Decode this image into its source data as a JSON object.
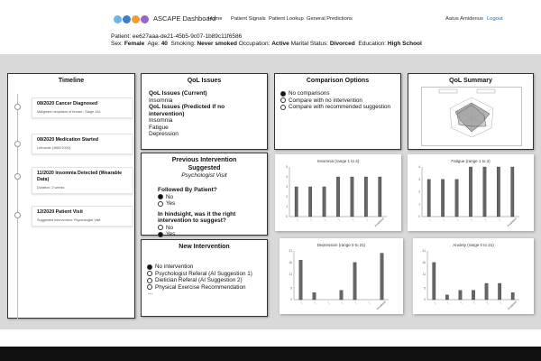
{
  "nav": {
    "brand": "ASCAPE Dashboard",
    "links": [
      "Home",
      "Patient Signals",
      "Patient Lookup",
      "General Predictions"
    ],
    "user": "Aatus Amidenus",
    "logout": "Logout",
    "logo_colors": [
      "#6bb7e8",
      "#3a7fc9",
      "#f29c38",
      "#9c64c9",
      "#58b96e"
    ]
  },
  "patient": {
    "label": "Patient:",
    "id": "ee627aaa-de21-45b5-9c07-1b89c11f6586",
    "sex_label": "Sex:",
    "sex": "Female",
    "age_label": "Age:",
    "age": "40",
    "smoking_label": "Smoking:",
    "smoking": "Never smoked",
    "occupation_label": "Occupation:",
    "occupation": "Active",
    "marital_label": "Marital Status:",
    "marital": "Divorced",
    "education_label": "Education:",
    "education": "High School"
  },
  "timeline": {
    "title": "Timeline",
    "items": [
      {
        "title": "08/2020 Cancer Diagnosed",
        "sub": "Malignant neoplasm of breast - Stage 1A1"
      },
      {
        "title": "08/2020 Medication Started",
        "sub": "Letrozole (1660/1000)"
      },
      {
        "title": "11/2020 Insomnia Detected (Wearable Data)",
        "sub": "Duration: 2 weeks"
      },
      {
        "title": "12/2020 Patient Visit",
        "sub": "Suggested intervention: Psychologist Visit"
      }
    ]
  },
  "qol_issues": {
    "title": "QoL Issues",
    "current_label": "QoL Issues (Current)",
    "current": [
      "Insomnia"
    ],
    "predicted_label": "QoL Issues (Predicted  if no intervention)",
    "predicted": [
      "Insomnia",
      "Fatigue",
      "Depression"
    ]
  },
  "comparison": {
    "title": "Comparison Options",
    "options": [
      "No comparisons",
      "Compare with no intervention",
      "Compare with recommended suggestion"
    ],
    "selected": 0
  },
  "previous_intervention": {
    "title": "Previous Intervention Suggested",
    "subtitle": "Psychologist Visit",
    "followed_label": "Followed By Patient?",
    "followed_options": [
      "No",
      "Yes"
    ],
    "followed_selected": 0,
    "hindsight_label": "In hindsight, was it the right intervention to suggest?",
    "hindsight_options": [
      "No",
      "Yes"
    ],
    "hindsight_selected": 1
  },
  "new_intervention": {
    "title": "New Intervention",
    "options": [
      "No intervention",
      "Psychologist Referal (AI Suggestion 1)",
      "Dietician Referal (AI Suggestion 2)",
      "Physical Exercise Recommendation"
    ],
    "selected": 0,
    "more": "..."
  },
  "qol_summary": {
    "title": "QoL Summary"
  },
  "chart_data": [
    {
      "type": "bar",
      "title": "Insomnia (range 1 to 4)",
      "values": [
        3,
        3,
        3,
        4,
        4,
        4,
        4
      ],
      "ylim": [
        0,
        5
      ],
      "x_last_label": "Predicted"
    },
    {
      "type": "bar",
      "title": "Fatigue (range 1 to 4)",
      "values": [
        3,
        3,
        3,
        4,
        4,
        4,
        4
      ],
      "ylim": [
        0,
        4
      ],
      "x_last_label": "Predicted"
    },
    {
      "type": "bar",
      "title": "Depression (range 0 to 21)",
      "values": [
        17,
        3,
        0,
        4,
        16,
        0,
        20
      ],
      "ylim": [
        0,
        21
      ],
      "x_last_label": "Predicted"
    },
    {
      "type": "bar",
      "title": "Anxiety (range 0 to 21)",
      "values": [
        16,
        2,
        4,
        4,
        7,
        7,
        3
      ],
      "ylim": [
        0,
        21
      ],
      "x_last_label": "Predicted"
    }
  ]
}
